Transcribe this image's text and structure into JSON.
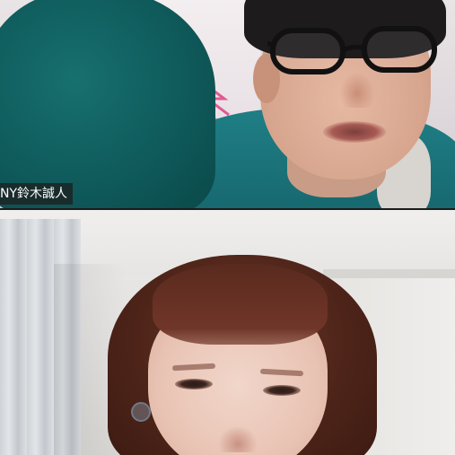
{
  "participants": [
    {
      "position": "top",
      "display_name": "NY鈴木誠人",
      "shows_name_tag": true
    },
    {
      "position": "bottom",
      "display_name": "",
      "shows_name_tag": false
    }
  ],
  "colors": {
    "name_tag_background": "#1e1e1e",
    "name_tag_text": "#ffffff",
    "tile_divider": "#1b1b1b"
  }
}
